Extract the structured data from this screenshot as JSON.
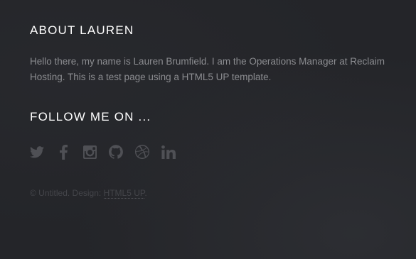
{
  "about": {
    "heading": "About Lauren",
    "text": "Hello there, my name is Lauren Brumfield. I am the Operations Manager at Reclaim Hosting. This is a test page using a HTML5 UP template."
  },
  "follow": {
    "heading": "Follow me on ...",
    "icons": [
      "twitter-icon",
      "facebook-icon",
      "instagram-icon",
      "github-icon",
      "dribbble-icon",
      "linkedin-icon"
    ]
  },
  "copyright": {
    "prefix": "© Untitled. Design: ",
    "link_label": "HTML5 UP",
    "suffix": "."
  },
  "colors": {
    "background": "#242529",
    "heading": "#ffffff",
    "body_text": "#8b8c90",
    "icon": "#4f5055",
    "muted": "#44454a"
  }
}
